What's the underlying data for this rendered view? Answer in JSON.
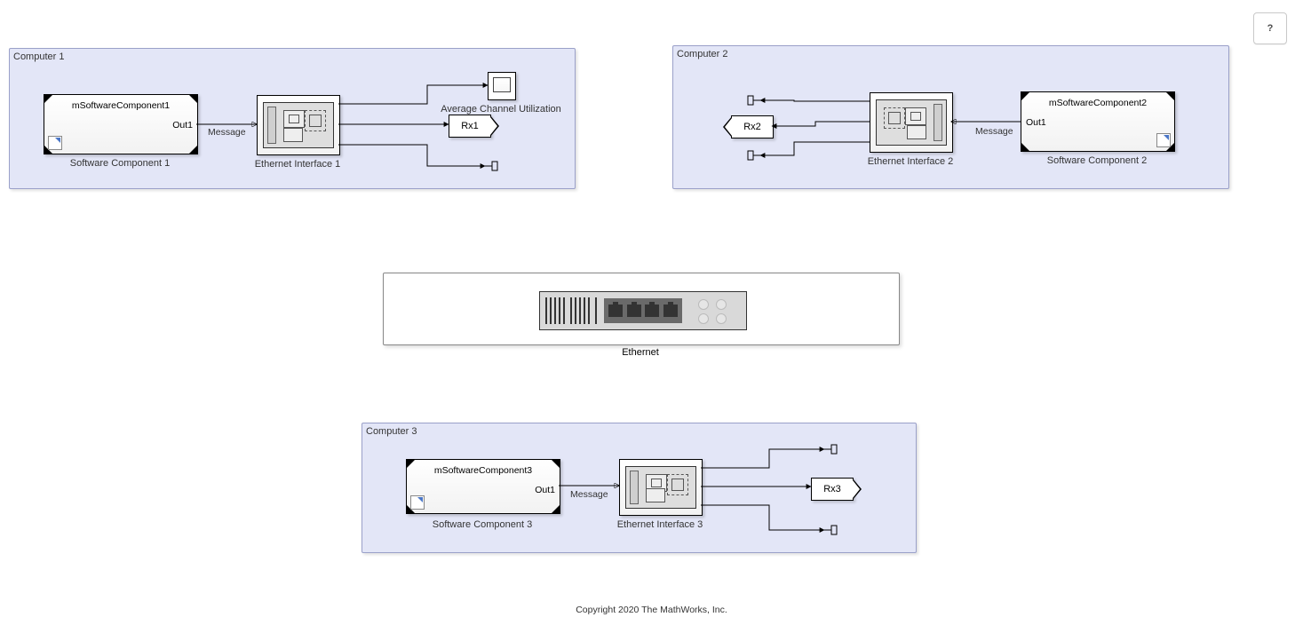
{
  "help_label": "?",
  "group1": {
    "title": "Computer 1",
    "sw": {
      "name": "mSoftwareComponent1",
      "port": "Out1",
      "label": "Software Component 1"
    },
    "nic": {
      "label": "Ethernet Interface 1"
    },
    "scope": {
      "label": "Average Channel Utilization"
    },
    "rx": {
      "text": "Rx1"
    },
    "msg": "Message"
  },
  "group2": {
    "title": "Computer 2",
    "sw": {
      "name": "mSoftwareComponent2",
      "port": "Out1",
      "label": "Software Component 2"
    },
    "nic": {
      "label": "Ethernet Interface 2"
    },
    "rx": {
      "text": "Rx2"
    },
    "msg": "Message"
  },
  "group3": {
    "title": "Computer 3",
    "sw": {
      "name": "mSoftwareComponent3",
      "port": "Out1",
      "label": "Software Component 3"
    },
    "nic": {
      "label": "Ethernet Interface 3"
    },
    "rx": {
      "text": "Rx3"
    },
    "msg": "Message"
  },
  "ethernet_label": "Ethernet",
  "copyright": "Copyright 2020 The MathWorks, Inc."
}
